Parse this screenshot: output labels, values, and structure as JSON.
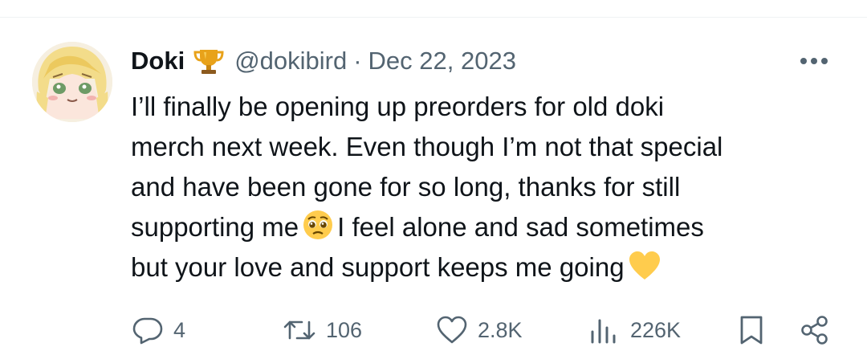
{
  "tweet": {
    "display_name": "Doki",
    "badge_icon": "trophy-icon",
    "handle": "@dokibird",
    "separator": "·",
    "date": "Dec 22, 2023",
    "body_lines": [
      [
        "I’ll finally be opening up preorders for old doki"
      ],
      [
        "merch next week. Even though I’m not that special"
      ],
      [
        "and have been gone for so long, thanks for still"
      ],
      [
        "supporting me",
        "I feel alone and sad sometimes"
      ],
      [
        "but your love and support keeps me going"
      ]
    ],
    "emojis": [
      "pleading-face-emoji",
      "yellow-heart-emoji"
    ],
    "more_icon": "more-options-icon"
  },
  "actions": {
    "replies": "4",
    "reposts": "106",
    "likes": "2.8K",
    "views": "226K",
    "icons": [
      "reply-icon",
      "repost-icon",
      "like-icon",
      "views-icon",
      "bookmark-icon",
      "share-icon"
    ]
  },
  "colors": {
    "text": "#0f1419",
    "secondary": "#536471",
    "trophy": "#e8a21a",
    "heart": "#ffcc4d"
  }
}
